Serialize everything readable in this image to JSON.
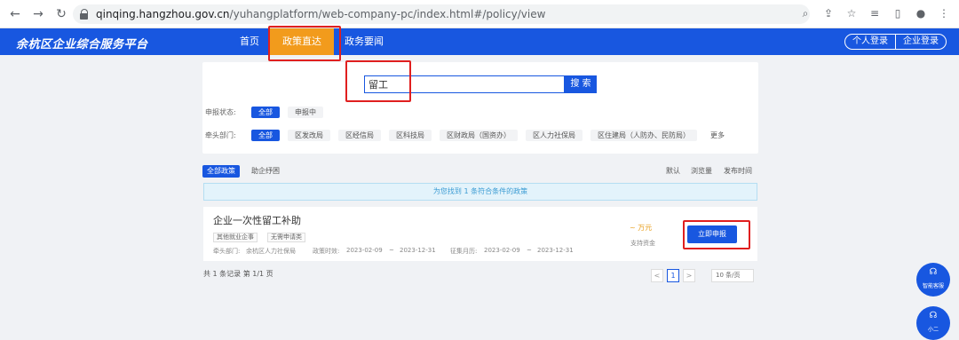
{
  "browser": {
    "url_host": "qinqing.hangzhou.gov.cn",
    "url_path": "/yuhangplatform/web-company-pc/index.html#/policy/view"
  },
  "header": {
    "logo": "余杭区企业综合服务平台",
    "nav": [
      "首页",
      "政策直达",
      "政务要闻"
    ],
    "personal_login": "个人登录",
    "company_login": "企业登录"
  },
  "search": {
    "value": "留工",
    "button": "搜 索"
  },
  "filters": {
    "status_label": "申报状态:",
    "status_options": [
      "全部",
      "申报中"
    ],
    "dept_label": "牵头部门:",
    "dept_options": [
      "全部",
      "区发改局",
      "区经信局",
      "区科技局",
      "区财政局（国资办）",
      "区人力社保局",
      "区住建局（人防办、民防局）"
    ],
    "more": "更多"
  },
  "tabs": {
    "all": "全部政策",
    "relief": "助企纾困"
  },
  "sort": [
    "默认",
    "浏览量",
    "发布时间"
  ],
  "result_text": "为您找到 1 条符合条件的政策",
  "policy": {
    "title": "企业一次性留工补助",
    "tags": [
      "其他就业企事",
      "无需申请类"
    ],
    "dept_label": "牵头部门:",
    "dept": "余杭区人力社保局",
    "valid_label": "政策时效:",
    "valid_start": "2023-02-09",
    "valid_end": "2023-12-31",
    "collect_label": "征集月历:",
    "collect_start": "2023-02-09",
    "collect_end": "2023-12-31",
    "tilde": "~",
    "amount": "~ 万元",
    "fund_type": "支持资金",
    "apply": "立即申报"
  },
  "pagination": {
    "total": "共 1 条记录 第 1/1 页",
    "current": "1",
    "prev": "<",
    "next": ">",
    "page_size": "10 条/页"
  },
  "floating": {
    "service": "智能客服",
    "assistant": "小二"
  },
  "colors": {
    "primary": "#1857e0",
    "active_nav": "#f29b1c",
    "highlight": "#e01f1f"
  }
}
